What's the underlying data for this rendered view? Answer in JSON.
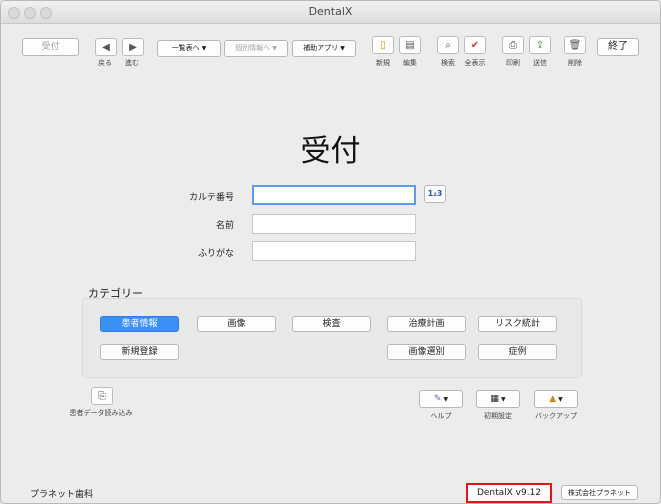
{
  "window": {
    "title": "DentalX"
  },
  "toolbar": {
    "reception": "受付",
    "back": "戻る",
    "forward": "進む",
    "to_list": "一覧表へ",
    "to_detail": "個別情報へ",
    "aux_app": "補助アプリ",
    "new": "新規",
    "edit": "編集",
    "search": "検索",
    "show_all": "全表示",
    "print": "印刷",
    "send": "送信",
    "delete": "削除",
    "quit": "終了"
  },
  "page": {
    "title": "受付"
  },
  "form": {
    "chart_no_label": "カルテ番号",
    "chart_no_value": "",
    "name_label": "名前",
    "name_value": "",
    "kana_label": "ふりがな",
    "kana_value": "",
    "numpad_label": "1₂3"
  },
  "category": {
    "label": "カテゴリー",
    "row1": [
      "患者情報",
      "画像",
      "検査",
      "治療計画",
      "リスク統計"
    ],
    "row2": [
      "新規登録",
      "画像選別",
      "症例"
    ],
    "active": "患者情報"
  },
  "bottom": {
    "import_label": "患者データ読み込み",
    "help": "ヘルプ",
    "initial_settings": "初期設定",
    "backup": "バックアップ"
  },
  "footer": {
    "clinic": "プラネット歯科",
    "version": "DentalX v9.12",
    "company": "株式会社プラネット"
  },
  "colors": {
    "accent": "#3c8ff5",
    "highlight": "#e01616"
  }
}
